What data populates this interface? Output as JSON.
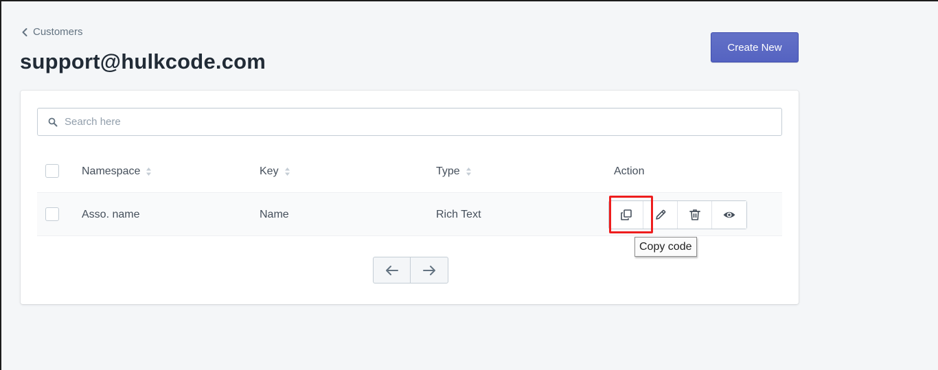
{
  "breadcrumb": {
    "label": "Customers",
    "icon": "chevron-left-icon"
  },
  "page": {
    "title": "support@hulkcode.com"
  },
  "toolbar": {
    "create_label": "Create New",
    "accent": "#5c6ac4"
  },
  "search": {
    "placeholder": "Search here",
    "value": "",
    "icon": "search-icon"
  },
  "table": {
    "columns": [
      "Namespace",
      "Key",
      "Type",
      "Action"
    ],
    "rows": [
      {
        "namespace": "Asso. name",
        "key": "Name",
        "type": "Rich Text"
      }
    ]
  },
  "actions": {
    "icons": [
      "copy-icon",
      "pencil-icon",
      "trash-icon",
      "eye-icon"
    ],
    "highlight_color": "#ee1d1d"
  },
  "tooltip": {
    "text": "Copy code"
  },
  "pagination": {
    "prev_icon": "arrow-left-icon",
    "next_icon": "arrow-right-icon"
  }
}
